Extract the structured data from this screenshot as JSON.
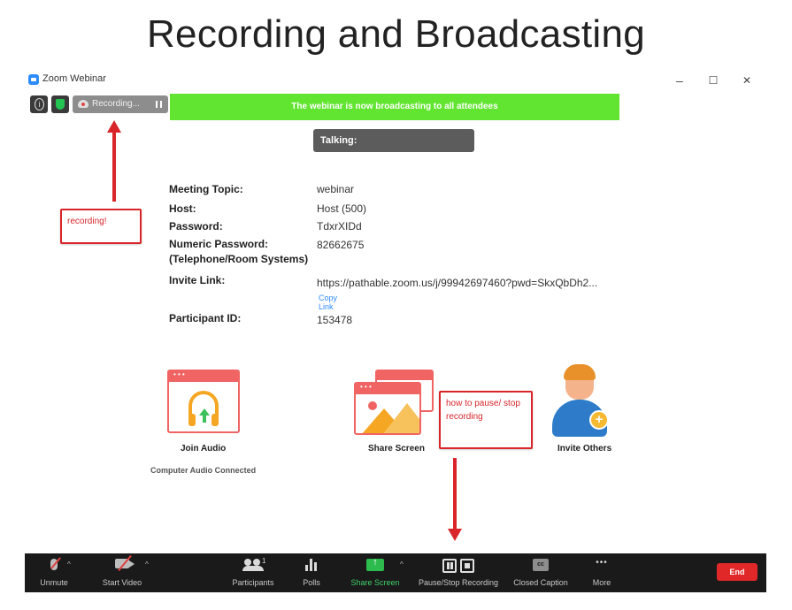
{
  "slide": {
    "title": "Recording and Broadcasting"
  },
  "window": {
    "app_title": "Zoom Webinar",
    "controls": {
      "minimize": "–",
      "maximize": "☐",
      "close": "✕"
    }
  },
  "recording_bar": {
    "label": "Recording..."
  },
  "banner": {
    "text": "The webinar is now broadcasting to all attendees"
  },
  "talking": {
    "label": "Talking:"
  },
  "meeting_info": [
    {
      "label": "Meeting Topic:",
      "value": "webinar"
    },
    {
      "label": "Host:",
      "value": "Host (500)"
    },
    {
      "label": "Password:",
      "value": "TdxrXIDd"
    },
    {
      "label": "Numeric Password:",
      "label2": "(Telephone/Room Systems)",
      "value": "82662675"
    },
    {
      "label": "Invite Link:",
      "value": "https://pathable.zoom.us/j/99942697460?pwd=SkxQbDh2..."
    },
    {
      "label": "Participant ID:",
      "value": "153478"
    }
  ],
  "copy_link": "Copy Link",
  "actions": {
    "join_audio": "Join Audio",
    "join_audio_status": "Computer Audio Connected",
    "share_screen": "Share Screen",
    "invite_others": "Invite Others"
  },
  "annotations": {
    "recording": "recording!",
    "pause_stop": "how to pause/ stop recording"
  },
  "toolbar": {
    "unmute": "Unmute",
    "start_video": "Start Video",
    "participants": "Participants",
    "participants_count": "1",
    "polls": "Polls",
    "share_screen": "Share Screen",
    "pause_stop": "Pause/Stop Recording",
    "closed_caption": "Closed Caption",
    "cc_badge": "cc",
    "more": "More",
    "end": "End"
  },
  "colors": {
    "banner_green": "#62e530",
    "annotation_red": "#d9252a",
    "share_green": "#2dbb4e",
    "end_red": "#e02828",
    "zoom_blue": "#2d8cff"
  }
}
